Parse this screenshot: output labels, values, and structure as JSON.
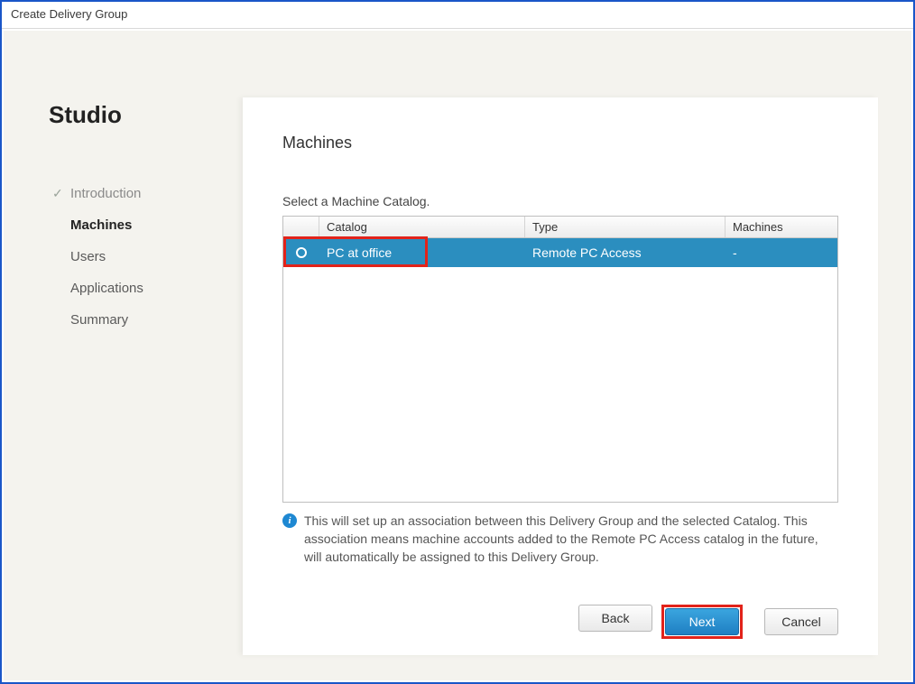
{
  "window": {
    "title": "Create Delivery Group"
  },
  "brand": "Studio",
  "steps": [
    {
      "label": "Introduction",
      "state": "done"
    },
    {
      "label": "Machines",
      "state": "current"
    },
    {
      "label": "Users",
      "state": ""
    },
    {
      "label": "Applications",
      "state": ""
    },
    {
      "label": "Summary",
      "state": ""
    }
  ],
  "panel": {
    "title": "Machines",
    "subtitle": "Select a Machine Catalog.",
    "columns": {
      "catalog": "Catalog",
      "type": "Type",
      "machines": "Machines"
    },
    "rows": [
      {
        "catalog": "PC at office",
        "type": "Remote PC Access",
        "machines": "-"
      }
    ],
    "info": "This will set up an association between this Delivery Group and the selected Catalog. This association means machine accounts added to the Remote PC Access catalog in the future, will automatically be assigned to this Delivery Group."
  },
  "buttons": {
    "back": "Back",
    "next": "Next",
    "cancel": "Cancel"
  }
}
